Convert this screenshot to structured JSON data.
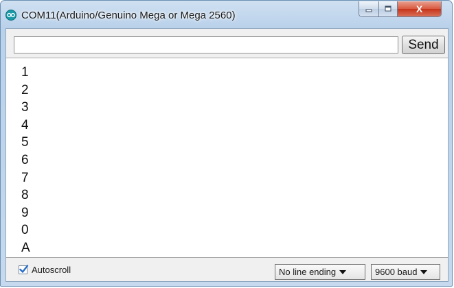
{
  "window": {
    "title": "COM11(Arduino/Genuino Mega or Mega 2560)",
    "buttons": {
      "minimize_icon": "minimize-icon",
      "maximize_icon": "maximize-icon",
      "close_glyph": "X"
    }
  },
  "send_bar": {
    "input_value": "",
    "send_label": "Send"
  },
  "serial_output": {
    "lines": [
      "1",
      "2",
      "3",
      "4",
      "5",
      "6",
      "7",
      "8",
      "9",
      "0",
      "A"
    ]
  },
  "footer": {
    "autoscroll_label": "Autoscroll",
    "autoscroll_checked": true,
    "line_ending_selected": "No line ending",
    "baud_selected": "9600 baud"
  },
  "colors": {
    "app_icon": "#1a9aa8",
    "close_button": "#d9583f",
    "checkbox_check": "#2a6fc9"
  }
}
